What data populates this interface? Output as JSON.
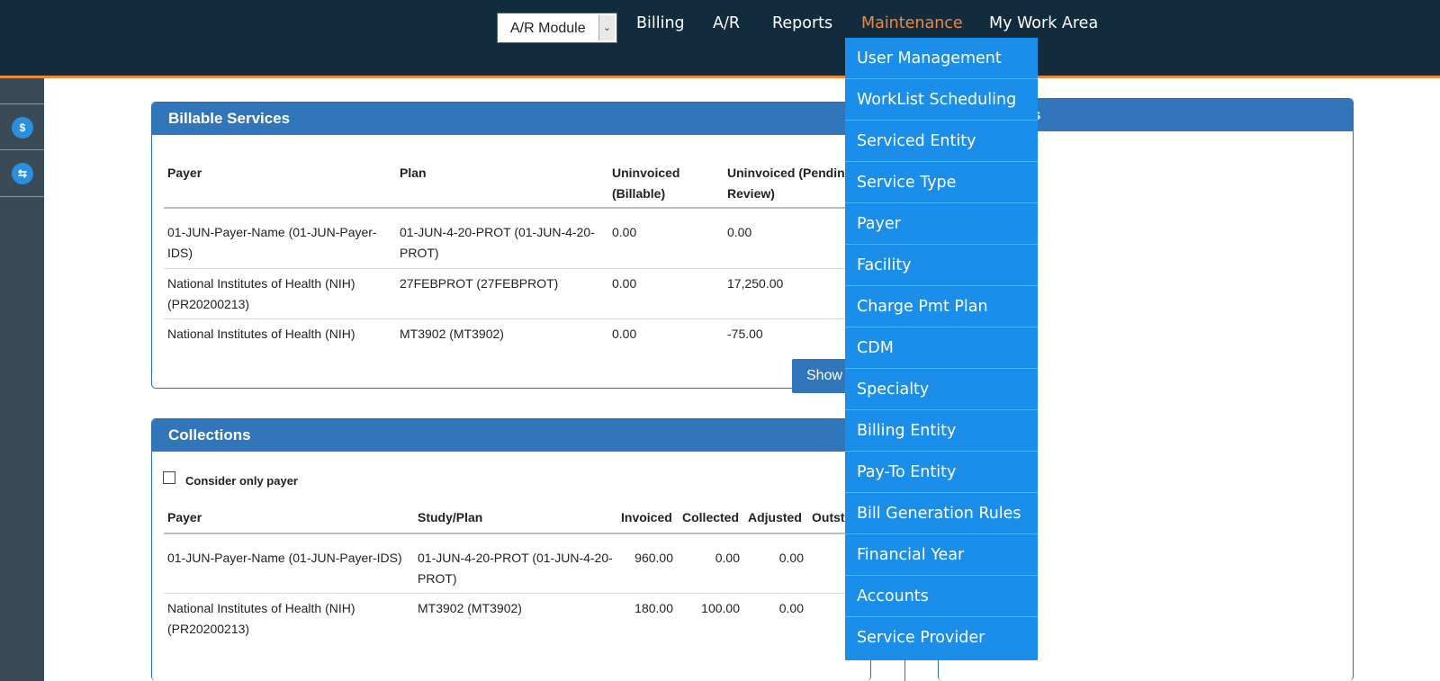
{
  "header": {
    "module_select": "A/R Module",
    "nav": [
      "Billing",
      "A/R",
      "Reports",
      "Maintenance",
      "My Work Area"
    ]
  },
  "maintenance_menu": [
    "User Management",
    "WorkList Scheduling",
    "Serviced Entity",
    "Service Type",
    "Payer",
    "Facility",
    "Charge Pmt Plan",
    "CDM",
    "Specialty",
    "Billing Entity",
    "Pay-To Entity",
    "Bill Generation Rules",
    "Financial Year",
    "Accounts",
    "Service Provider"
  ],
  "right_panel": {
    "title_fragment": "s"
  },
  "billable": {
    "title": "Billable Services",
    "columns": {
      "payer": "Payer",
      "plan": "Plan",
      "uninv_billable": "Uninvoiced (Billable)",
      "uninv_pending": "Uninvoiced (Pending Review)"
    },
    "rows": [
      {
        "payer": "01-JUN-Payer-Name (01-JUN-Payer-IDS)",
        "plan": "01-JUN-4-20-PROT (01-JUN-4-20-PROT)",
        "billable": "0.00",
        "pending": "0.00"
      },
      {
        "payer": "National Institutes of Health (NIH) (PR20200213)",
        "plan": "27FEBPROT (27FEBPROT)",
        "billable": "0.00",
        "pending": "17,250.00"
      },
      {
        "payer": "National Institutes of Health (NIH)",
        "plan": "MT3902 (MT3902)",
        "billable": "0.00",
        "pending": "-75.00"
      }
    ],
    "show_button": "Show"
  },
  "collections": {
    "title": "Collections",
    "checkbox_label": "Consider only payer",
    "columns": {
      "payer": "Payer",
      "study": "Study/Plan",
      "invoiced": "Invoiced",
      "collected": "Collected",
      "adjusted": "Adjusted",
      "outstanding": "Outst"
    },
    "rows": [
      {
        "payer": "01-JUN-Payer-Name (01-JUN-Payer-IDS)",
        "study": "01-JUN-4-20-PROT (01-JUN-4-20-PROT)",
        "invoiced": "960.00",
        "collected": "0.00",
        "adjusted": "0.00"
      },
      {
        "payer": "National Institutes of Health (NIH) (PR20200213)",
        "study": "MT3902 (MT3902)",
        "invoiced": "180.00",
        "collected": "100.00",
        "adjusted": "0.00"
      }
    ]
  }
}
